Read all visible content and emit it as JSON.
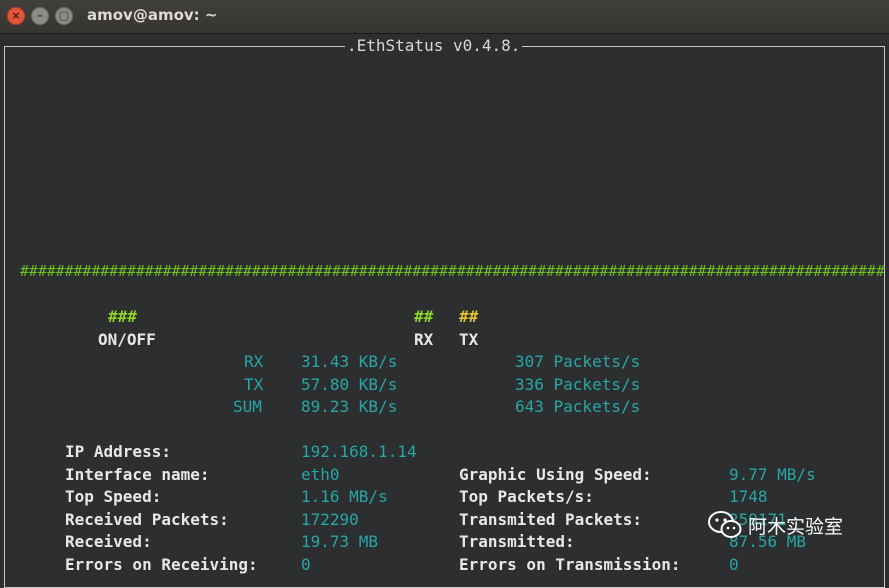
{
  "window": {
    "title": "amov@amov: ~"
  },
  "app": {
    "header": ".EthStatus v0.4.8."
  },
  "graph": {
    "hash_row": "#################################################################################################"
  },
  "legend": {
    "onoff_marks": "###",
    "onoff_label": "ON/OFF",
    "rx_marks": "##",
    "rx_label": "RX",
    "tx_marks": "##",
    "tx_label": "TX"
  },
  "rates": [
    {
      "label": "RX",
      "speed": "31.43 KB/s",
      "packets": "307 Packets/s"
    },
    {
      "label": "TX",
      "speed": "57.80 KB/s",
      "packets": "336 Packets/s"
    },
    {
      "label": "SUM",
      "speed": "89.23 KB/s",
      "packets": "643 Packets/s"
    }
  ],
  "stats_left": [
    {
      "label": "IP Address:",
      "value": "192.168.1.14"
    },
    {
      "label": "Interface name:",
      "value": "eth0"
    },
    {
      "label": "Top Speed:",
      "value": "1.16 MB/s"
    },
    {
      "label": "Received Packets:",
      "value": "172290"
    },
    {
      "label": "Received:",
      "value": "19.73 MB"
    },
    {
      "label": "Errors on Receiving:",
      "value": "0"
    }
  ],
  "stats_right": [
    {
      "label": "Graphic Using Speed:",
      "value": "9.77 MB/s"
    },
    {
      "label": "Top Packets/s:",
      "value": "1748"
    },
    {
      "label": "Transmited Packets:",
      "value": "259171"
    },
    {
      "label": "Transmitted:",
      "value": "87.56 MB"
    },
    {
      "label": "Errors on Transmission:",
      "value": "0"
    }
  ],
  "watermark": {
    "text": "阿木实验室",
    "icon": "wechat-icon"
  }
}
